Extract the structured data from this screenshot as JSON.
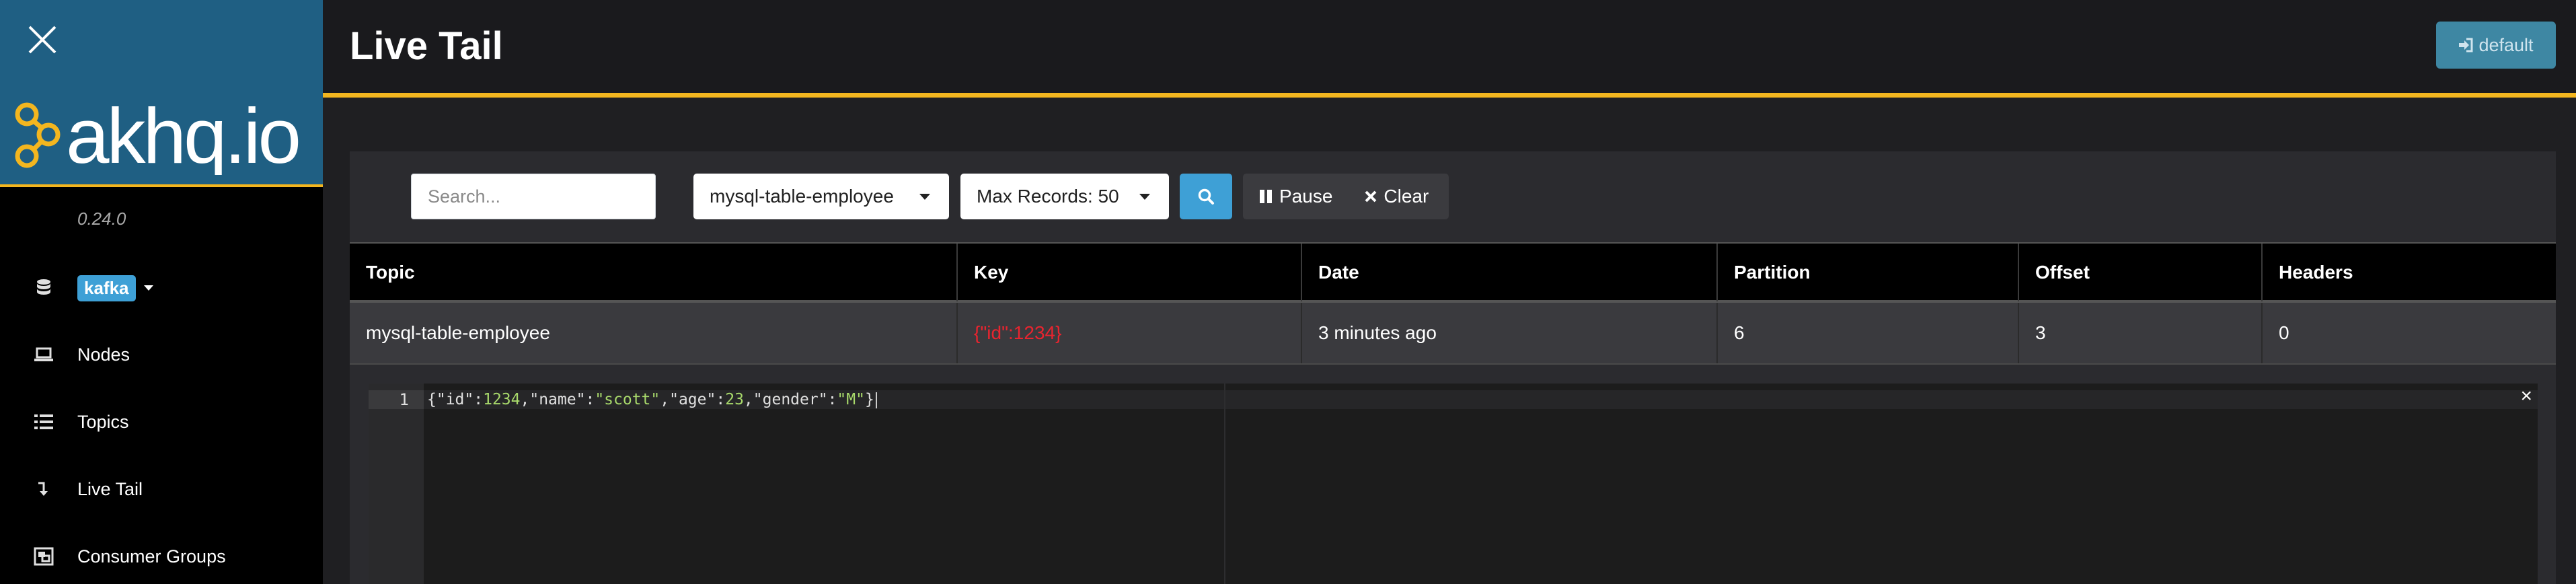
{
  "sidebar": {
    "version": "0.24.0",
    "logo_text": "akhq.io",
    "cluster": "kafka",
    "items": [
      {
        "label": "Nodes",
        "icon": "laptop-icon"
      },
      {
        "label": "Topics",
        "icon": "list-icon"
      },
      {
        "label": "Live Tail",
        "icon": "level-down-icon"
      },
      {
        "label": "Consumer Groups",
        "icon": "object-group-icon"
      }
    ]
  },
  "header": {
    "title": "Live Tail",
    "login_label": "default"
  },
  "toolbar": {
    "search_placeholder": "Search...",
    "topic_select": "mysql-table-employee",
    "max_records_select": "Max Records: 50",
    "pause_label": "Pause",
    "clear_label": "Clear"
  },
  "table": {
    "columns": [
      "Topic",
      "Key",
      "Date",
      "Partition",
      "Offset",
      "Headers"
    ],
    "rows": [
      {
        "topic": "mysql-table-employee",
        "key": "{\"id\":1234}",
        "date": "3 minutes ago",
        "partition": "6",
        "offset": "3",
        "headers": "0"
      }
    ]
  },
  "editor": {
    "line_number": "1",
    "code": "{\"id\":1234,\"name\":\"scott\",\"age\":23,\"gender\":\"M\"}",
    "close_symbol": "×"
  },
  "colors": {
    "brand": "#1f5f83",
    "accent": "#f3b61f",
    "primary": "#3ea0d6",
    "key_text": "#e8242f"
  }
}
